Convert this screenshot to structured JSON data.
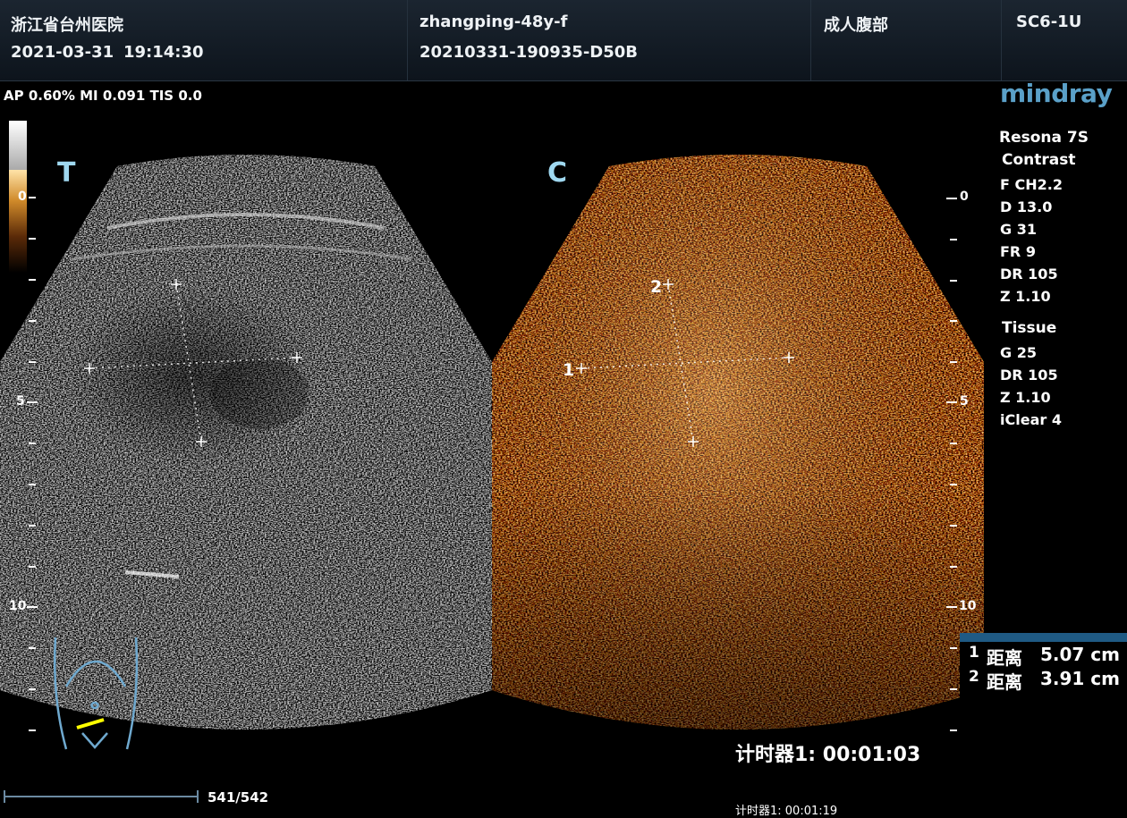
{
  "header": {
    "hospital": "浙江省台州医院",
    "date": "2021-03-31",
    "time": "19:14:30",
    "patient": "zhangping-48y-f",
    "exam_id": "20210331-190935-D50B",
    "exam_type": "成人腹部",
    "probe": "SC6-1U"
  },
  "acoustic": "AP 0.60%  MI 0.091 TIS 0.0",
  "brand": "mindray",
  "system": {
    "model": "Resona 7S",
    "mode": "Contrast",
    "contrast_params": [
      "F CH2.2",
      "D 13.0",
      "G 31",
      "FR 9",
      "DR 105",
      "Z 1.10"
    ],
    "tissue_label": "Tissue",
    "tissue_params": [
      "G 25",
      "DR 105",
      "Z 1.10",
      "iClear 4"
    ]
  },
  "colorbar_label": "0",
  "panels": {
    "left": "T",
    "right": "C"
  },
  "depth_scale": {
    "labels": [
      "0",
      "5",
      "10"
    ]
  },
  "right_scale_labels": [
    "0",
    "5",
    "10"
  ],
  "caliper_labels": [
    "1",
    "2"
  ],
  "measurements": [
    {
      "index": "1",
      "label": "距离",
      "value": "5.07 cm"
    },
    {
      "index": "2",
      "label": "距离",
      "value": "3.91 cm"
    }
  ],
  "timer_main": "计时器1: 00:01:03",
  "timer_secondary": "计时器1: 00:01:19",
  "frame_counter": "541/542",
  "colors": {
    "accent": "#5aa0c8",
    "header_bg": "#151f29",
    "contrast_amber": "#d08a2a",
    "measure_bar": "#1f5a84"
  }
}
